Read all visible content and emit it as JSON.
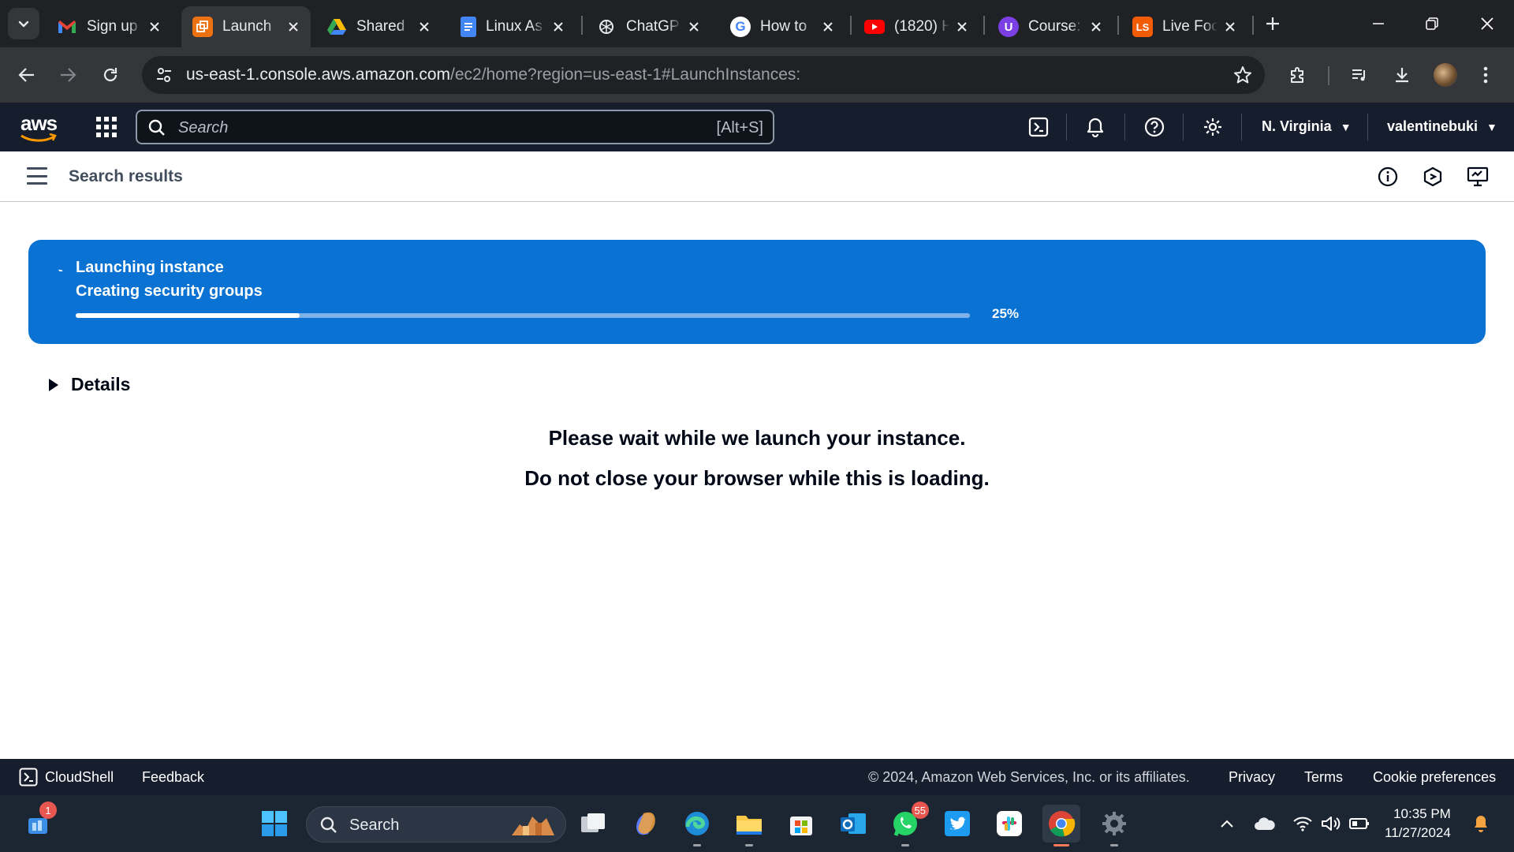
{
  "browser": {
    "tabs": [
      {
        "title": "Sign up",
        "icon": "gmail-icon",
        "color": "#ea4335"
      },
      {
        "title": "Launch",
        "icon": "aws-launch-icon",
        "color": "#ec7211",
        "active": true
      },
      {
        "title": "Shared",
        "icon": "google-drive-icon",
        "color": "#34a853"
      },
      {
        "title": "Linux As",
        "icon": "google-docs-icon",
        "color": "#4285f4"
      },
      {
        "title": "ChatGP",
        "icon": "chatgpt-icon",
        "color": "#e8eaed"
      },
      {
        "title": "How to",
        "icon": "google-icon",
        "color": "#4285f4"
      },
      {
        "title": "(1820) H",
        "icon": "youtube-icon",
        "color": "#ff0000"
      },
      {
        "title": "Course:",
        "icon": "course-icon",
        "color": "#7b3fe4"
      },
      {
        "title": "Live Foc",
        "icon": "live-icon",
        "color": "#f25c05"
      }
    ],
    "url_host": "us-east-1.console.aws.amazon.com",
    "url_path": "/ec2/home?region=us-east-1#LaunchInstances:"
  },
  "aws_nav": {
    "search_placeholder": "Search",
    "search_shortcut": "[Alt+S]",
    "region": "N. Virginia",
    "user": "valentinebuki"
  },
  "page": {
    "title": "Search results"
  },
  "progress": {
    "heading": "Launching instance",
    "step": "Creating security groups",
    "percent_value": 0.25,
    "percent_label": "25%",
    "color": "#0972d3"
  },
  "details": {
    "label": "Details"
  },
  "messages": {
    "line1": "Please wait while we launch your instance.",
    "line2": "Do not close your browser while this is loading."
  },
  "footer": {
    "cloudshell": "CloudShell",
    "feedback": "Feedback",
    "copyright": "© 2024, Amazon Web Services, Inc. or its affiliates.",
    "privacy": "Privacy",
    "terms": "Terms",
    "cookies": "Cookie preferences"
  },
  "taskbar": {
    "search_placeholder": "Search",
    "widgets_badge": "1",
    "whatsapp_badge": "55",
    "time": "10:35 PM",
    "date": "11/27/2024"
  }
}
